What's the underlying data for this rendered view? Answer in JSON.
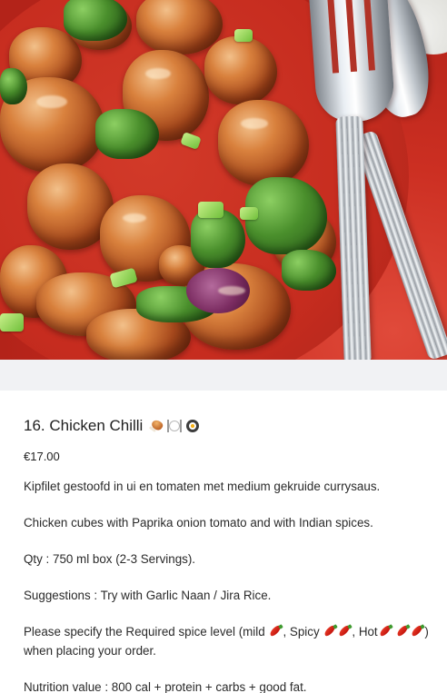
{
  "product": {
    "photo_alt": "Chicken Chilli dish with fork and spoon on red plate",
    "title": "16. Chicken Chilli",
    "title_emojis": [
      "drumstick-icon",
      "plate-cutlery-icon",
      "pan-egg-icon"
    ],
    "price": "€17.00",
    "description_nl": "Kipfilet gestoofd in ui en tomaten met medium gekruide currysaus.",
    "description_en": "Chicken cubes with Paprika onion tomato and with Indian spices.",
    "quantity": "Qty : 750 ml box (2-3 Servings).",
    "suggestions": "Suggestions : Try with Garlic Naan / Jira Rice.",
    "spice": {
      "intro": "Please specify the Required spice level (mild",
      "spicy_label": ", Spicy",
      "hot_label": ", Hot",
      "outro": ") when placing your order."
    },
    "nutrition": "Nutrition value : 800 cal + protein + carbs + good fat."
  },
  "colors": {
    "plate_red": "#c62c1f",
    "band_grey": "#f1f2f4",
    "chili_red": "#c81a10"
  }
}
